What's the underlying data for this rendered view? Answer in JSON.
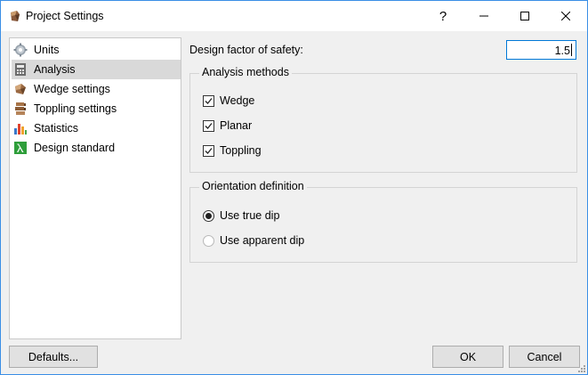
{
  "window": {
    "title": "Project Settings",
    "help_glyph": "?",
    "accent": "#0078d7"
  },
  "nav": {
    "items": [
      {
        "label": "Units",
        "icon": "gear-icon"
      },
      {
        "label": "Analysis",
        "icon": "calculator-icon",
        "selected": true
      },
      {
        "label": "Wedge settings",
        "icon": "wedge-block-icon"
      },
      {
        "label": "Toppling settings",
        "icon": "toppling-blocks-icon"
      },
      {
        "label": "Statistics",
        "icon": "bar-chart-icon"
      },
      {
        "label": "Design standard",
        "icon": "lambda-icon"
      }
    ]
  },
  "main": {
    "fos_label": "Design factor of safety:",
    "fos_value": "1.5",
    "analysis_methods": {
      "title": "Analysis methods",
      "items": [
        {
          "label": "Wedge",
          "checked": true
        },
        {
          "label": "Planar",
          "checked": true
        },
        {
          "label": "Toppling",
          "checked": true
        }
      ]
    },
    "orientation": {
      "title": "Orientation definition",
      "options": [
        {
          "label": "Use true dip",
          "selected": true
        },
        {
          "label": "Use apparent dip",
          "selected": false
        }
      ]
    }
  },
  "footer": {
    "defaults_label": "Defaults...",
    "ok_label": "OK",
    "cancel_label": "Cancel"
  }
}
